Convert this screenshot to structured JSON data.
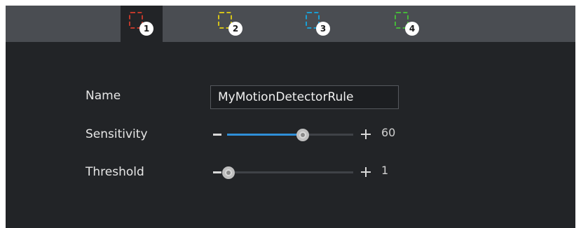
{
  "tabs": [
    {
      "number": "1",
      "color": "#c0392b",
      "active": true
    },
    {
      "number": "2",
      "color": "#d4c21a",
      "active": false
    },
    {
      "number": "3",
      "color": "#1a9fd4",
      "active": false
    },
    {
      "number": "4",
      "color": "#46b83a",
      "active": false
    }
  ],
  "form": {
    "name_label": "Name",
    "name_value": "MyMotionDetectorRule",
    "sensitivity_label": "Sensitivity",
    "sensitivity_value": "60",
    "sensitivity_fraction": 0.6,
    "threshold_label": "Threshold",
    "threshold_value": "1",
    "threshold_fraction": 0.01
  },
  "colors": {
    "accent": "#2f8fd8"
  }
}
